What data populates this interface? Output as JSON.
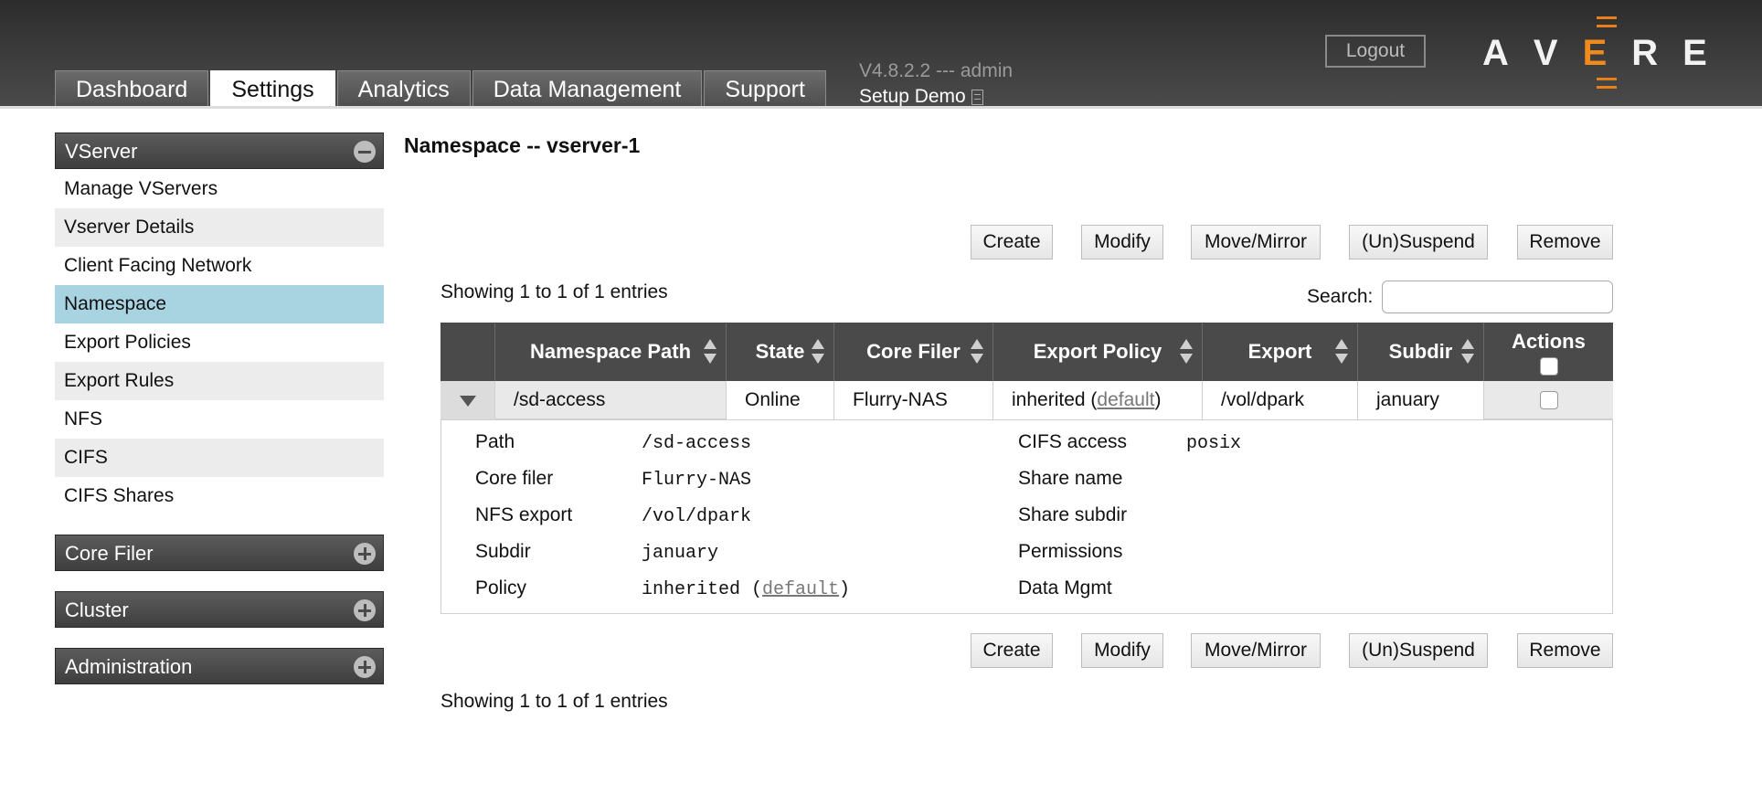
{
  "header": {
    "tabs": [
      {
        "label": "Dashboard"
      },
      {
        "label": "Settings"
      },
      {
        "label": "Analytics"
      },
      {
        "label": "Data Management"
      },
      {
        "label": "Support"
      }
    ],
    "active_tab": "Settings",
    "version": "V4.8.2.2 --- admin",
    "cluster_name": "Setup Demo",
    "logout_label": "Logout",
    "logo_letters": [
      "A",
      "V",
      "E",
      "R",
      "E"
    ],
    "accent_color": "#f08a1c"
  },
  "sidebar": {
    "vserver_section": {
      "title": "VServer",
      "expanded": true,
      "items": [
        {
          "label": "Manage VServers"
        },
        {
          "label": "Vserver Details"
        },
        {
          "label": "Client Facing Network"
        },
        {
          "label": "Namespace"
        },
        {
          "label": "Export Policies"
        },
        {
          "label": "Export Rules"
        },
        {
          "label": "NFS"
        },
        {
          "label": "CIFS"
        },
        {
          "label": "CIFS Shares"
        }
      ],
      "selected": "Namespace"
    },
    "other_sections": [
      {
        "title": "Core Filer"
      },
      {
        "title": "Cluster"
      },
      {
        "title": "Administration"
      }
    ],
    "selection_color": "#a8d4e2"
  },
  "main": {
    "title": "Namespace -- vserver-1",
    "buttons": {
      "create": "Create",
      "modify": "Modify",
      "move_mirror": "Move/Mirror",
      "suspend": "(Un)Suspend",
      "remove": "Remove"
    },
    "entries_info": "Showing 1 to 1 of 1 entries",
    "search_label": "Search:",
    "search_value": "",
    "table": {
      "columns": [
        "Namespace Path",
        "State",
        "Core Filer",
        "Export Policy",
        "Export",
        "Subdir",
        "Actions"
      ],
      "rows": [
        {
          "path": "/sd-access",
          "state": "Online",
          "core_filer": "Flurry-NAS",
          "policy_prefix": "inherited (",
          "policy_link": "default",
          "policy_suffix": ")",
          "export": "/vol/dpark",
          "subdir": "january"
        }
      ]
    },
    "details": {
      "left": [
        {
          "label": "Path",
          "value": "/sd-access"
        },
        {
          "label": "Core filer",
          "value": "Flurry-NAS"
        },
        {
          "label": "NFS export",
          "value": "/vol/dpark"
        },
        {
          "label": "Subdir",
          "value": "january"
        },
        {
          "label": "Policy",
          "value_prefix": "inherited (",
          "value_link": "default",
          "value_suffix": ")"
        }
      ],
      "right": [
        {
          "label": "CIFS access",
          "value": "posix"
        },
        {
          "label": "Share name",
          "value": ""
        },
        {
          "label": "Share subdir",
          "value": ""
        },
        {
          "label": "Permissions",
          "value": ""
        },
        {
          "label": "Data Mgmt",
          "value": ""
        }
      ]
    }
  }
}
